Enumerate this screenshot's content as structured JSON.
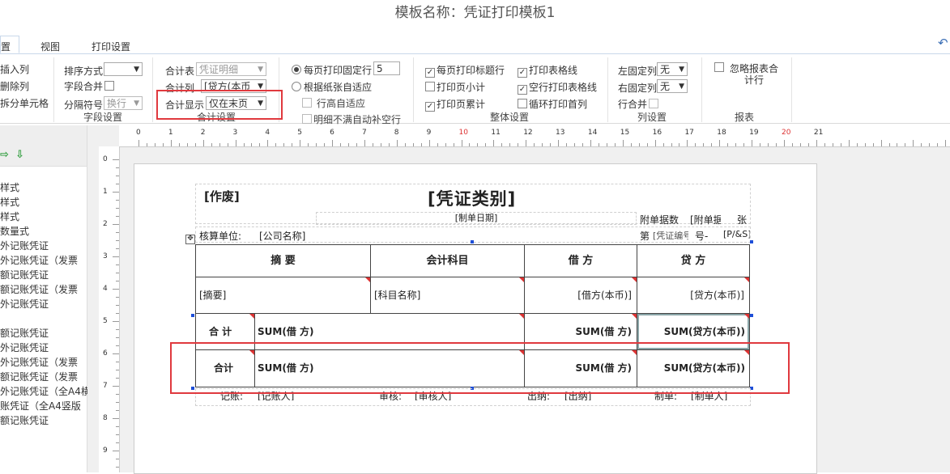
{
  "window_title": "模板名称：凭证打印模板1",
  "tabs": {
    "active": "置",
    "view": "视图",
    "print_settings": "打印设置"
  },
  "ribbon": {
    "col1": {
      "insert_col": "插入列",
      "delete_col": "删除列",
      "split_cell": "拆分单元格"
    },
    "field": {
      "sort_label": "排序方式",
      "sort_value": "",
      "field_merge_label": "字段合并",
      "separator_label": "分隔符号",
      "separator_value": "换行",
      "group": "字段设置"
    },
    "total": {
      "table_label": "合计表",
      "table_value": "凭证明细",
      "col_label": "合计列",
      "col_value": "[贷方(本币",
      "display_label": "合计显示",
      "display_value": "仅在末页",
      "group": "合计设置"
    },
    "page": {
      "fixed_rows_label": "每页打印固定行",
      "fixed_rows_value": "5",
      "by_paper_label": "根据纸张自适应",
      "row_height_label": "行高自适应",
      "fill_empty_label": "明细不满自动补空行"
    },
    "overall": {
      "print_title": "每页打印标题行",
      "print_grid": "打印表格线",
      "page_subtotal": "打印页小计",
      "empty_grid": "空行打印表格线",
      "page_cumulative": "打印页累计",
      "loop_first_row": "循环打印首列",
      "group": "整体设置"
    },
    "column": {
      "left_fixed_label": "左固定列",
      "left_fixed_value": "无",
      "right_fixed_label": "右固定列",
      "right_fixed_value": "无",
      "row_merge_label": "行合并",
      "group": "列设置"
    },
    "report": {
      "ignore_total": "忽略报表合计行",
      "group": "报表"
    }
  },
  "sidebar": {
    "items": [
      "样式",
      "样式",
      "样式",
      "数量式",
      "外记账凭证",
      "外记账凭证（发票",
      "额记账凭证",
      "额记账凭证（发票",
      "外记账凭证",
      "",
      "额记账凭证",
      "外记账凭证",
      "外记账凭证（发票",
      "额记账凭证（发票",
      "外记账凭证（全A4横",
      "账凭证（全A4竖版",
      "额记账凭证"
    ]
  },
  "ruler": {
    "h": [
      "0",
      "1",
      "2",
      "3",
      "4",
      "5",
      "6",
      "7",
      "8",
      "9",
      "10",
      "11",
      "12",
      "13",
      "14",
      "15",
      "16",
      "17",
      "18",
      "19",
      "20",
      "21"
    ],
    "v": [
      "0",
      "1",
      "2",
      "3",
      "4",
      "5",
      "6",
      "7",
      "8",
      "9"
    ]
  },
  "voucher": {
    "void_label": "[作废]",
    "type_label": "[凭证类别]",
    "date_label": "[制单日期]",
    "attach_label": "附单据数",
    "attach_count": "[附单据",
    "attach_unit": "张",
    "unit_label": "核算单位:",
    "unit_value": "[公司名称]",
    "page_info_a": "第",
    "page_info_b": "[凭证编号]",
    "page_info_c": "号-",
    "page_info_d": "[P/&S]",
    "headers": [
      "摘  要",
      "会计科目",
      "借  方",
      "贷  方"
    ],
    "detail": [
      "[摘要]",
      "[科目名称]",
      "[借方(本币)]",
      "[贷方(本币)]"
    ],
    "total_row1": {
      "label": "合  计",
      "sum1": "SUM(借  方)",
      "sum2": "SUM(借  方)",
      "sum3": "SUM(贷方(本币))"
    },
    "total_row2": {
      "label": "合计",
      "sum1": "SUM(借  方)",
      "sum2": "SUM(借  方)",
      "sum3": "SUM(贷方(本币))"
    },
    "footer": {
      "bookkeeper_label": "记账:",
      "bookkeeper_value": "[记账人]",
      "auditor_label": "审核:",
      "auditor_value": "[审核人]",
      "cashier_label": "出纳:",
      "cashier_value": "[出纳]",
      "maker_label": "制单:",
      "maker_value": "[制单人]"
    }
  },
  "colors": {
    "highlight": "#e0393e",
    "corner": "#dd3333",
    "handle": "#1d4ed8"
  }
}
